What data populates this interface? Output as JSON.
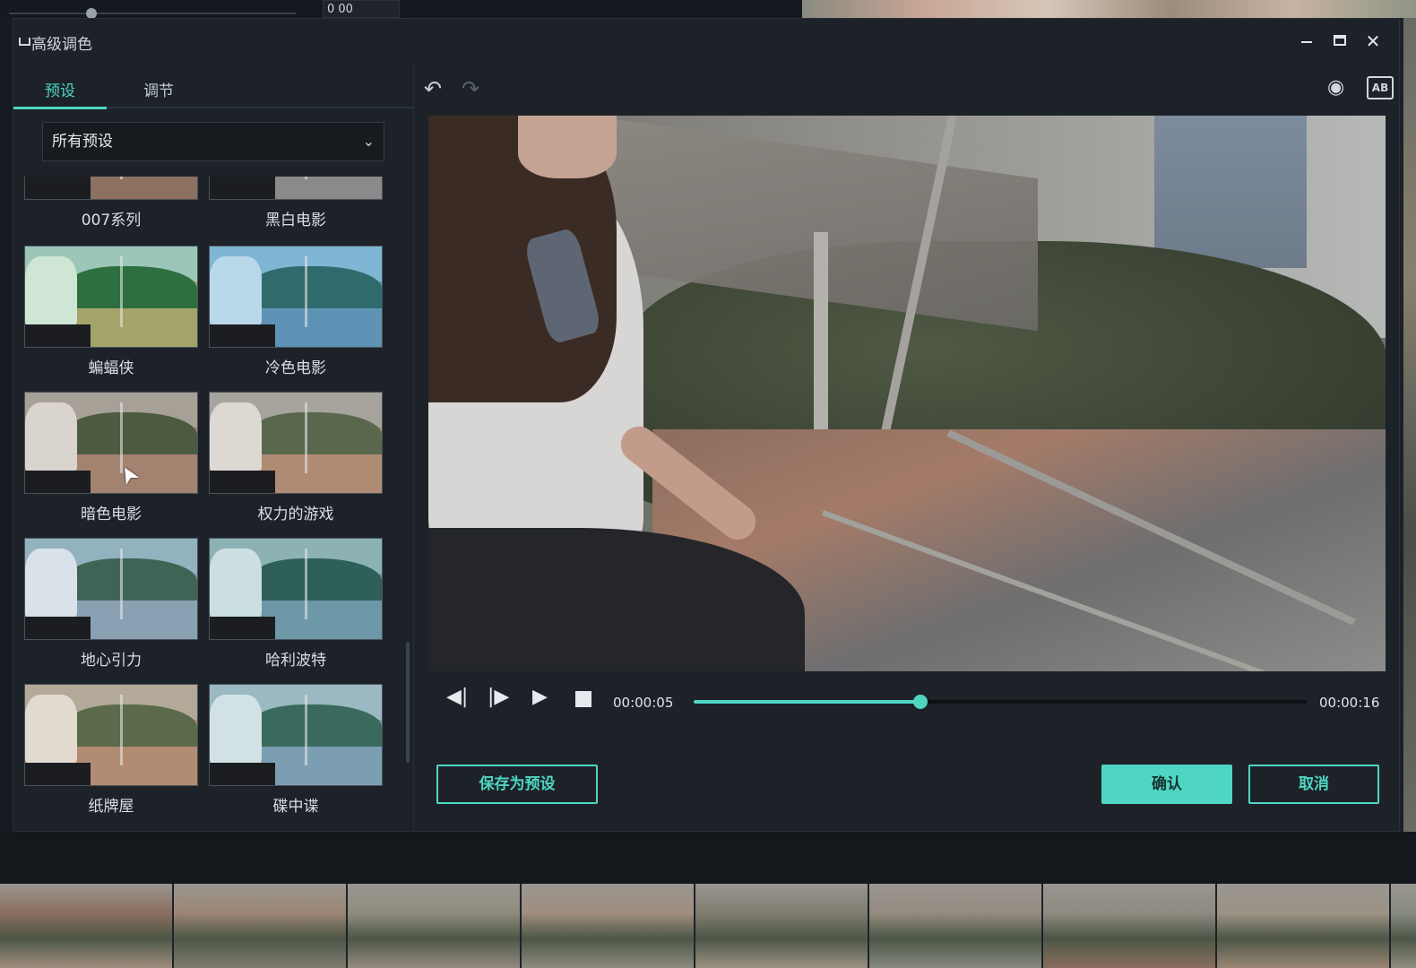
{
  "background": {
    "timecode": "0 00"
  },
  "dialog": {
    "title": "高级调色",
    "window_controls": {
      "minimize_icon": "minimize-icon",
      "maximize_icon": "maximize-icon",
      "close_icon": "close-icon"
    }
  },
  "tabs": [
    {
      "label": "预设",
      "active": true
    },
    {
      "label": "调节",
      "active": false
    }
  ],
  "preset_filter": {
    "selected": "所有预设"
  },
  "presets": [
    {
      "label": "007系列"
    },
    {
      "label": "黑白电影"
    },
    {
      "label": "蝙蝠侠"
    },
    {
      "label": "冷色电影"
    },
    {
      "label": "暗色电影"
    },
    {
      "label": "权力的游戏"
    },
    {
      "label": "地心引力"
    },
    {
      "label": "哈利波特"
    },
    {
      "label": "纸牌屋"
    },
    {
      "label": "碟中谍"
    }
  ],
  "player": {
    "current_time": "00:00:05",
    "total_time": "00:00:16",
    "progress": 0.37
  },
  "buttons": {
    "save_preset": "保存为预设",
    "confirm": "确认",
    "cancel": "取消"
  },
  "toolbar": {
    "compare_label": "AB"
  },
  "colors": {
    "accent": "#4fd6c3",
    "panel": "#1d2229"
  }
}
